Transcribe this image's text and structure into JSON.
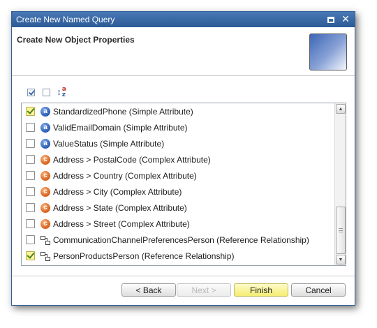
{
  "window": {
    "title": "Create New Named Query",
    "restore_icon": "restore-icon",
    "close_icon": "close-icon"
  },
  "header": {
    "heading": "Create New Object Properties",
    "graphic_icon": "wizard-banner-graphic"
  },
  "toolbar": {
    "tools": [
      {
        "name": "check-all-icon"
      },
      {
        "name": "uncheck-all-icon"
      },
      {
        "name": "sort-az-icon",
        "glyph_top": "a",
        "glyph_bottom": "z"
      }
    ]
  },
  "properties": [
    {
      "label": "StandardizedPhone (Simple Attribute)",
      "type": "simple",
      "checked": true
    },
    {
      "label": "ValidEmailDomain (Simple Attribute)",
      "type": "simple",
      "checked": false
    },
    {
      "label": "ValueStatus (Simple Attribute)",
      "type": "simple",
      "checked": false
    },
    {
      "label": "Address > PostalCode (Complex Attribute)",
      "type": "complex",
      "checked": false
    },
    {
      "label": "Address > Country (Complex Attribute)",
      "type": "complex",
      "checked": false
    },
    {
      "label": "Address > City (Complex Attribute)",
      "type": "complex",
      "checked": false
    },
    {
      "label": "Address > State (Complex Attribute)",
      "type": "complex",
      "checked": false
    },
    {
      "label": "Address > Street (Complex Attribute)",
      "type": "complex",
      "checked": false
    },
    {
      "label": "CommunicationChannelPreferencesPerson (Reference Relationship)",
      "type": "reference",
      "checked": false
    },
    {
      "label": "PersonProductsPerson (Reference Relationship)",
      "type": "reference",
      "checked": true
    }
  ],
  "icon_glyphs": {
    "simple": "a",
    "complex": "c"
  },
  "scroll": {
    "position": "bottom"
  },
  "buttons": {
    "back": "< Back",
    "next": "Next >",
    "finish": "Finish",
    "cancel": "Cancel"
  },
  "colors": {
    "titlebar": "#2f5f98",
    "checked_bg": "#fbf59a",
    "finish_bg": "#f4ec72"
  }
}
